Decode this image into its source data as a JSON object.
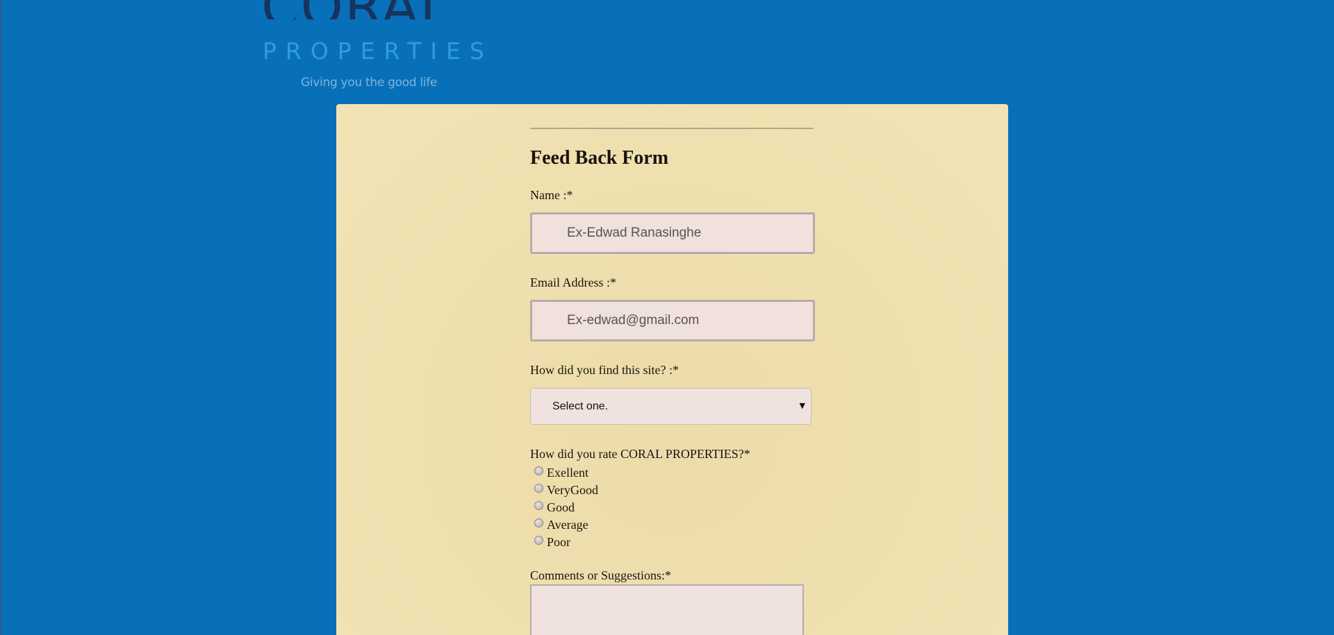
{
  "brand": {
    "name": "CORAL",
    "sub": "PROPERTIES",
    "tagline": "Giving you the good life"
  },
  "form": {
    "title": "Feed Back Form",
    "name_label": "Name :*",
    "name_value": "Ex-Edwad Ranasinghe",
    "email_label": "Email Address :*",
    "email_value": "Ex-edwad@gmail.com",
    "find_label": "How did you find this site? :*",
    "find_selected": "Select one.",
    "rate_label": "How did you rate CORAL PROPERTIES?*",
    "rate_options": [
      "Exellent",
      "VeryGood",
      "Good",
      "Average",
      "Poor"
    ],
    "comments_label": "Comments or Suggestions:*",
    "comments_value": ""
  },
  "colors": {
    "background": "#0870b9",
    "card": "#efe0b0",
    "input_bg": "#f0e1dc",
    "logo_dark": "#16345f",
    "logo_light": "#2f9ce0"
  },
  "icons": {
    "select_arrow": "caret-down-icon",
    "radio": "radio-button-icon"
  }
}
